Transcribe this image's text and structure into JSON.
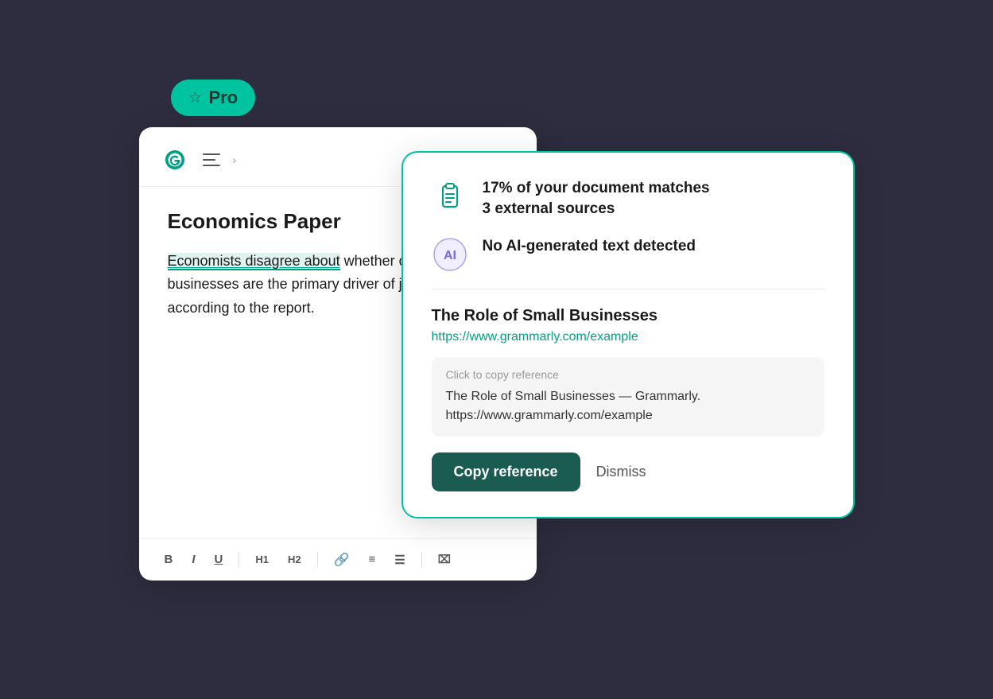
{
  "pro_badge": {
    "label": "Pro"
  },
  "editor": {
    "title": "Economics Paper",
    "body_plain": "whether or not small businesses are the primary driver of job growth, according to the report.",
    "highlighted": "Economists disagree about",
    "toolbar": {
      "bold": "B",
      "italic": "I",
      "underline": "U",
      "h1": "H1",
      "h2": "H2",
      "clear_format": "⌧"
    }
  },
  "info_panel": {
    "stat_line1": "17% of your document matches",
    "stat_line2": "3 external sources",
    "ai_label": "No AI-generated text detected",
    "source_title": "The Role of Small Businesses",
    "source_url": "https://www.grammarly.com/example",
    "ref_hint": "Click to copy reference",
    "ref_text": "The Role of Small Businesses — Grammarly.\nhttps://www.grammarly.com/example",
    "copy_btn": "Copy reference",
    "dismiss_btn": "Dismiss"
  }
}
